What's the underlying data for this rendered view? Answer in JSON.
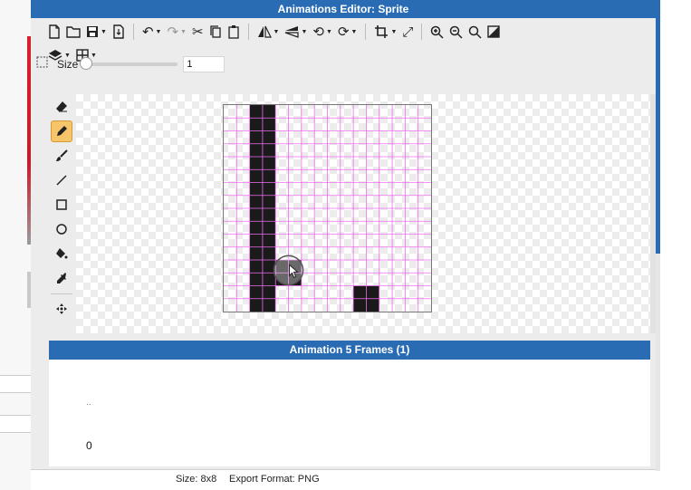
{
  "window": {
    "title": "Animations Editor: Sprite"
  },
  "toolbar": {
    "size_label": "Size",
    "size_value": "1",
    "size_slider_level": 0
  },
  "sprite": {
    "grid_size": 8,
    "filled_cells": [
      [
        1,
        0
      ],
      [
        1,
        1
      ],
      [
        1,
        2
      ],
      [
        1,
        3
      ],
      [
        1,
        4
      ],
      [
        1,
        5
      ],
      [
        1,
        6
      ],
      [
        2,
        6
      ],
      [
        1,
        7
      ],
      [
        5,
        7
      ]
    ],
    "pixel_color": "#1a1a1a",
    "grid_line_color": "#f06cf0"
  },
  "animation": {
    "title": "Animation 5 Frames (1)",
    "dots": "..",
    "frame_label": "0"
  },
  "status": {
    "size_text": "Size: 8x8",
    "export_text": "Export Format: PNG"
  },
  "colors": {
    "title_bar": "#2a6cb3",
    "active_tool": "#f6c46a"
  }
}
